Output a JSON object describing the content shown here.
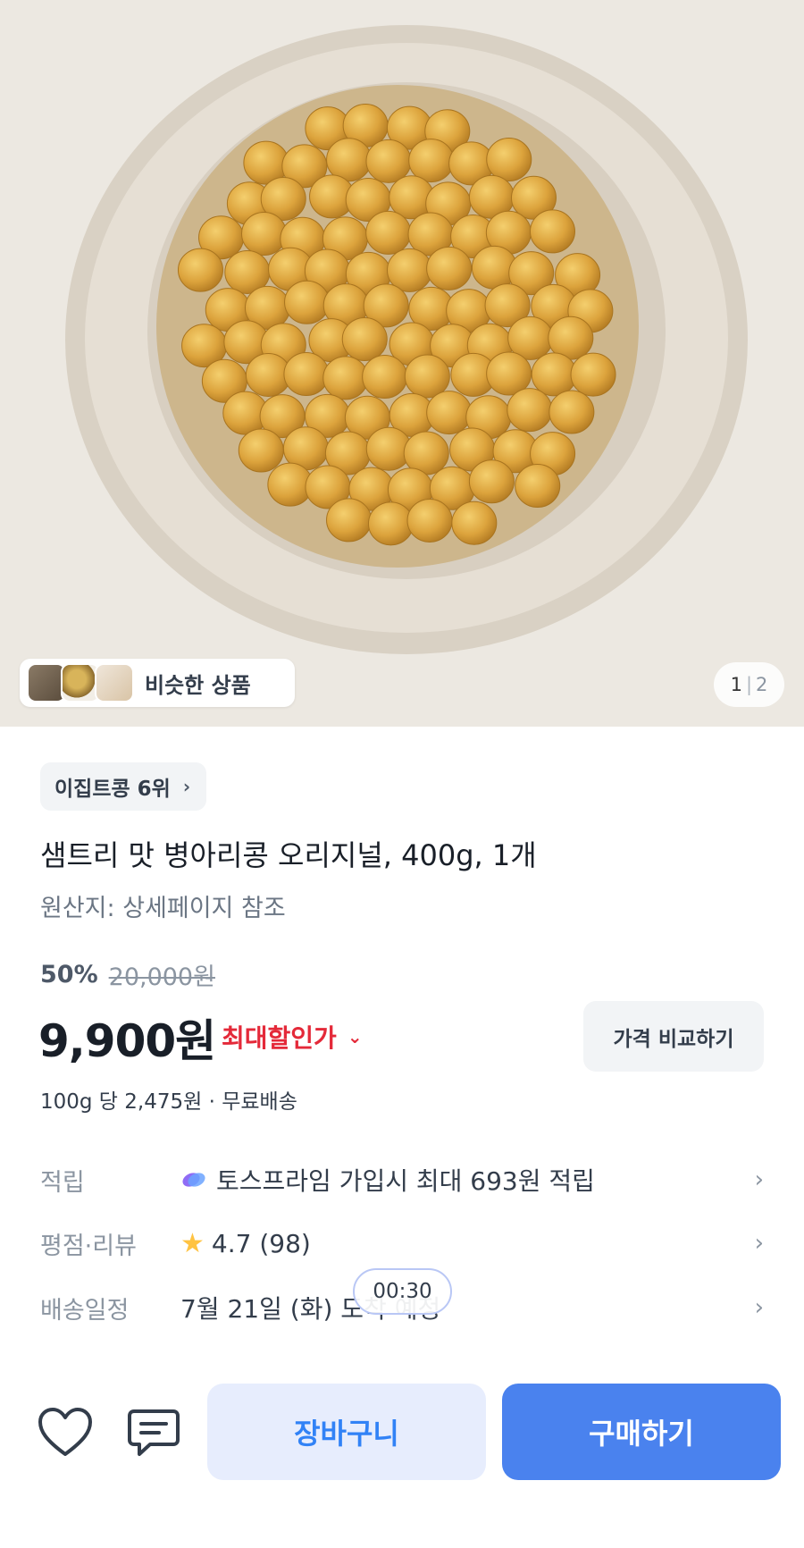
{
  "gallery": {
    "similar_label": "비슷한 상품",
    "pager_current": "1",
    "pager_total": "2"
  },
  "rank_chip": "이집트콩 6위",
  "product": {
    "title": "샘트리 맛 병아리콩 오리지널, 400g, 1개",
    "origin": "원산지: 상세페이지 참조"
  },
  "pricing": {
    "discount_rate": "50%",
    "original_price": "20,000원",
    "price": "9,900원",
    "max_discount_label": "최대할인가",
    "compare_button": "가격 비교하기",
    "unit_info": "100g 당 2,475원 · 무료배송"
  },
  "details": [
    {
      "key": "적립",
      "value": "토스프라임 가입시 최대 693원 적립"
    },
    {
      "key": "평점·리뷰",
      "value": "4.7 (98)"
    },
    {
      "key": "배송일정",
      "value": "7월 21일 (화) 도착 예정"
    }
  ],
  "timer": "00:30",
  "actions": {
    "cart": "장바구니",
    "buy": "구매하기"
  },
  "colors": {
    "accent": "#3182f6",
    "buy_button": "#4a82ee",
    "discount_red": "#e42939",
    "star": "#ffc342"
  }
}
